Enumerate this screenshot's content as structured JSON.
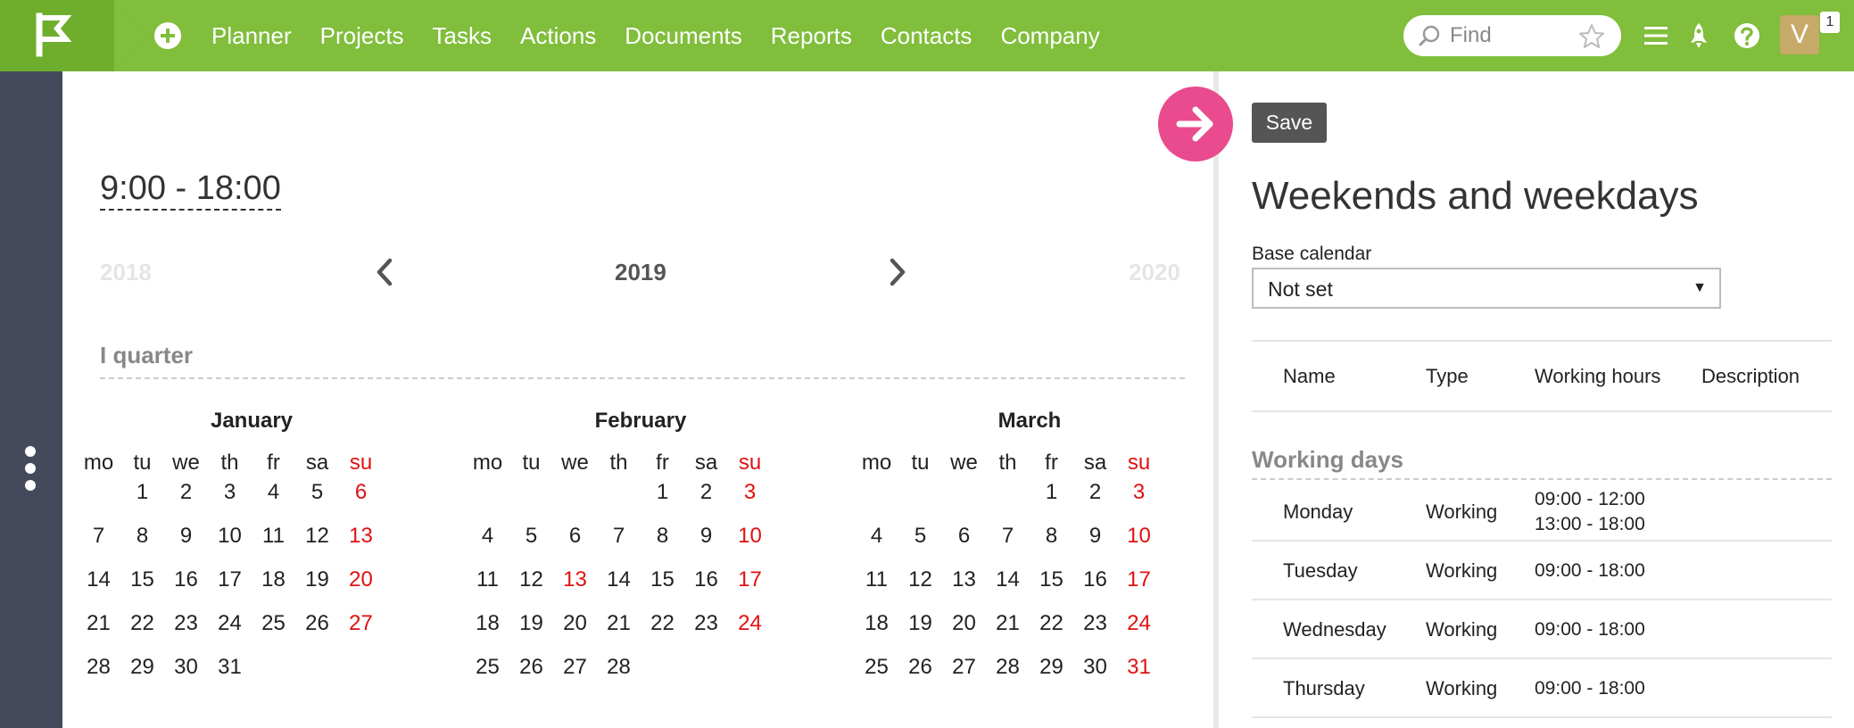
{
  "topbar": {
    "nav": [
      "Planner",
      "Projects",
      "Tasks",
      "Actions",
      "Documents",
      "Reports",
      "Contacts",
      "Company"
    ],
    "search_placeholder": "Find",
    "avatar_letter": "V",
    "notification_count": "1",
    "icons": [
      "flag-logo-icon",
      "plus-circle-icon",
      "search-icon",
      "star-icon",
      "menu-icon",
      "rocket-icon",
      "help-icon"
    ]
  },
  "calendar": {
    "working_hours": "9:00 - 18:00",
    "prev_year": "2018",
    "current_year": "2019",
    "next_year": "2020",
    "quarter_title": "I quarter",
    "weekday_headers": [
      "mo",
      "tu",
      "we",
      "th",
      "fr",
      "sa",
      "su"
    ],
    "months": [
      {
        "name": "January",
        "weeks": [
          [
            "",
            "1",
            "2",
            "3",
            "4",
            "5",
            "6"
          ],
          [
            "7",
            "8",
            "9",
            "10",
            "11",
            "12",
            "13"
          ],
          [
            "14",
            "15",
            "16",
            "17",
            "18",
            "19",
            "20"
          ],
          [
            "21",
            "22",
            "23",
            "24",
            "25",
            "26",
            "27"
          ],
          [
            "28",
            "29",
            "30",
            "31",
            "",
            "",
            ""
          ]
        ]
      },
      {
        "name": "February",
        "weeks": [
          [
            "",
            "",
            "",
            "",
            "1",
            "2",
            "3"
          ],
          [
            "4",
            "5",
            "6",
            "7",
            "8",
            "9",
            "10"
          ],
          [
            "11",
            "12",
            "13",
            "14",
            "15",
            "16",
            "17"
          ],
          [
            "18",
            "19",
            "20",
            "21",
            "22",
            "23",
            "24"
          ],
          [
            "25",
            "26",
            "27",
            "28",
            "",
            "",
            ""
          ]
        ],
        "extra_holidays": [
          "13"
        ]
      },
      {
        "name": "March",
        "weeks": [
          [
            "",
            "",
            "",
            "",
            "1",
            "2",
            "3"
          ],
          [
            "4",
            "5",
            "6",
            "7",
            "8",
            "9",
            "10"
          ],
          [
            "11",
            "12",
            "13",
            "14",
            "15",
            "16",
            "17"
          ],
          [
            "18",
            "19",
            "20",
            "21",
            "22",
            "23",
            "24"
          ],
          [
            "25",
            "26",
            "27",
            "28",
            "29",
            "30",
            "31"
          ]
        ]
      }
    ],
    "weekend_color": "#e01010"
  },
  "panel": {
    "save_label": "Save",
    "title": "Weekends and weekdays",
    "base_calendar_label": "Base calendar",
    "base_calendar_value": "Not set",
    "columns": [
      "Name",
      "Type",
      "Working hours",
      "Description"
    ],
    "section_title": "Working days",
    "rows": [
      {
        "name": "Monday",
        "type": "Working",
        "hours": [
          "09:00 - 12:00",
          "13:00 - 18:00"
        ],
        "description": ""
      },
      {
        "name": "Tuesday",
        "type": "Working",
        "hours": [
          "09:00 - 18:00"
        ],
        "description": ""
      },
      {
        "name": "Wednesday",
        "type": "Working",
        "hours": [
          "09:00 - 18:00"
        ],
        "description": ""
      },
      {
        "name": "Thursday",
        "type": "Working",
        "hours": [
          "09:00 - 18:00"
        ],
        "description": ""
      }
    ]
  },
  "colors": {
    "topbar_green": "#80be3c",
    "sidebar": "#444a5c",
    "collapse_button": "#e94b8e"
  }
}
